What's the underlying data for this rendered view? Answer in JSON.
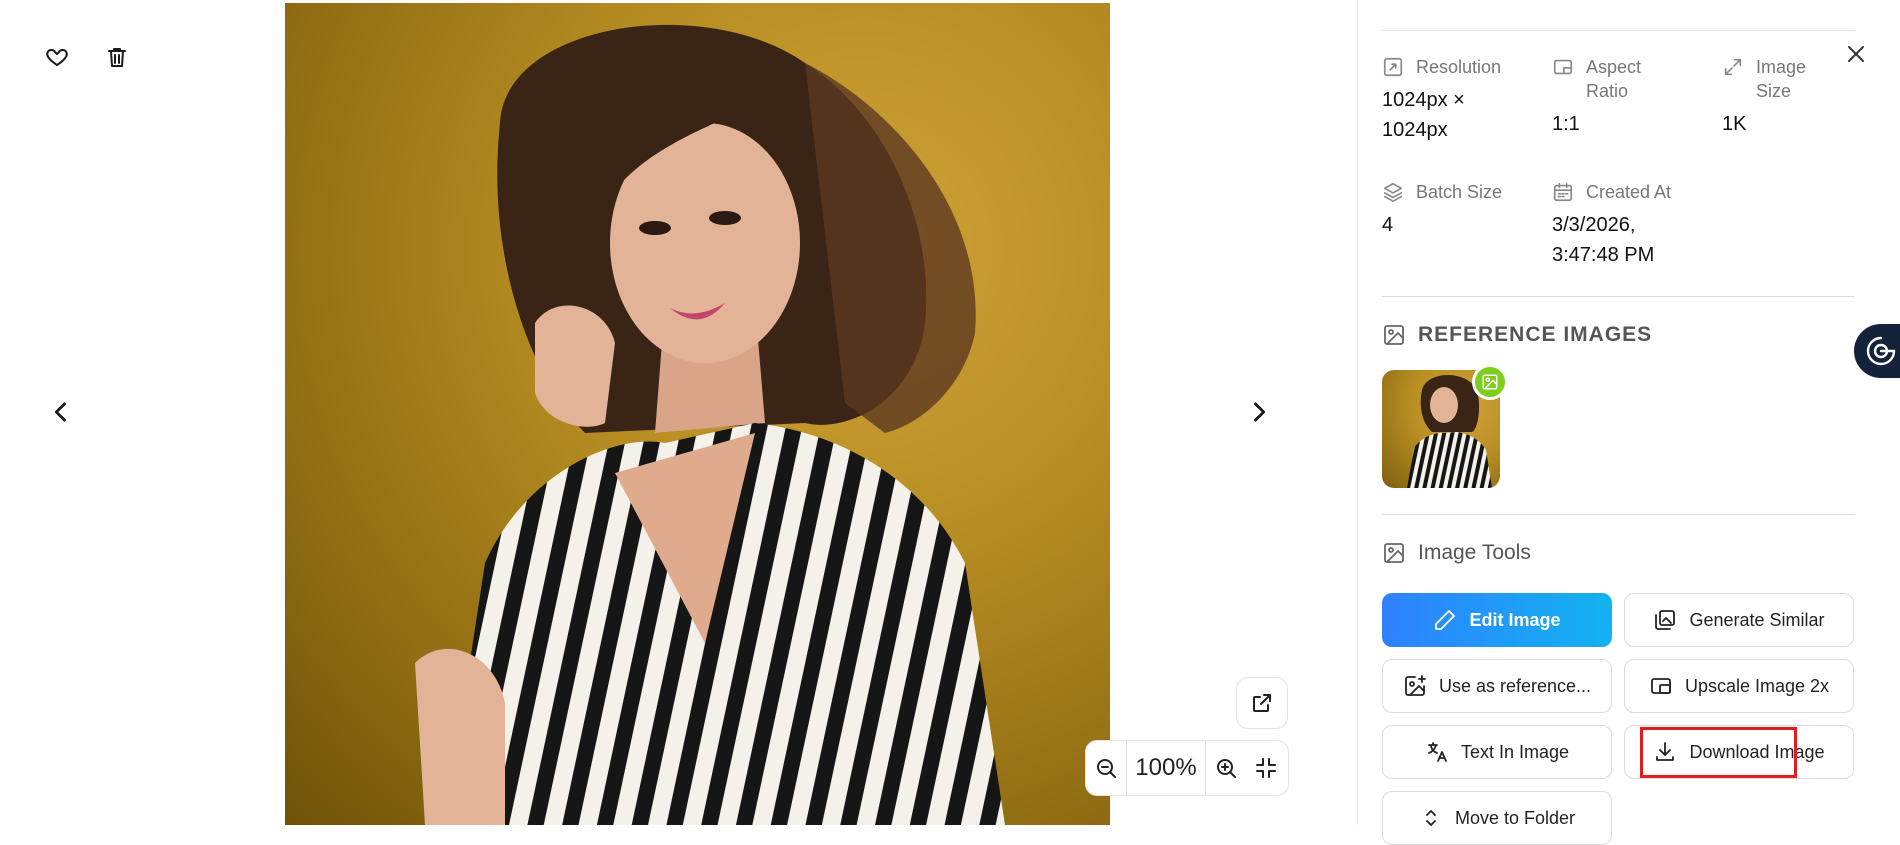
{
  "viewer": {
    "zoom_level": "100%",
    "icons": [
      "heart-icon",
      "trash-icon",
      "chevron-left-icon",
      "chevron-right-icon",
      "external-link-icon",
      "zoom-out-icon",
      "zoom-in-icon",
      "collapse-icon"
    ]
  },
  "details": {
    "resolution_label": "Resolution",
    "resolution_value_line1": "1024px ×",
    "resolution_value_line2": "1024px",
    "aspect_label_line1": "Aspect",
    "aspect_label_line2": "Ratio",
    "aspect_value": "1:1",
    "size_label_line1": "Image",
    "size_label_line2": "Size",
    "size_value": "1K",
    "batch_label": "Batch Size",
    "batch_value": "4",
    "created_label": "Created At",
    "created_value_line1": "3/3/2026,",
    "created_value_line2": "3:47:48 PM"
  },
  "reference": {
    "title": "REFERENCE IMAGES"
  },
  "tools": {
    "title": "Image Tools",
    "edit": "Edit Image",
    "generate_similar": "Generate Similar",
    "use_as_reference": "Use as reference...",
    "upscale": "Upscale Image 2x",
    "text_in_image": "Text In Image",
    "download": "Download Image",
    "move_to_folder": "Move to Folder"
  },
  "colors": {
    "accent_gradient_start": "#2f80ff",
    "accent_gradient_end": "#12b3f0",
    "highlight": "#e11d1d",
    "badge": "#7ccf1d",
    "photo_background": "#b98f24"
  }
}
